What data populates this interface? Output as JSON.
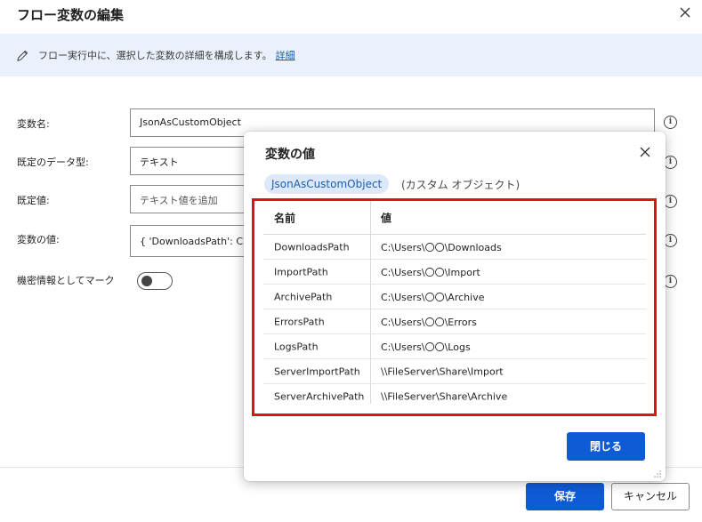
{
  "window": {
    "title": "フロー変数の編集"
  },
  "banner": {
    "text": "フロー実行中に、選択した変数の詳細を構成します。",
    "link": "詳細"
  },
  "form": {
    "name_label": "変数名:",
    "name_value": "JsonAsCustomObject",
    "type_label": "既定のデータ型:",
    "type_value": "テキスト",
    "default_label": "既定値:",
    "default_placeholder": "テキスト値を追加",
    "value_label": "変数の値:",
    "value_value": "{ 'DownloadsPath': C:\\Us",
    "sensitive_label": "機密情報としてマーク",
    "sensitive_on": false
  },
  "footer": {
    "save": "保存",
    "cancel": "キャンセル"
  },
  "dialog": {
    "title": "変数の値",
    "chip": "JsonAsCustomObject",
    "type_text": "(カスタム オブジェクト)",
    "columns": [
      "名前",
      "値"
    ],
    "rows": [
      [
        "DownloadsPath",
        "C:\\Users\\〇〇\\Downloads"
      ],
      [
        "ImportPath",
        "C:\\Users\\〇〇\\Import"
      ],
      [
        "ArchivePath",
        "C:\\Users\\〇〇\\Archive"
      ],
      [
        "ErrorsPath",
        "C:\\Users\\〇〇\\Errors"
      ],
      [
        "LogsPath",
        "C:\\Users\\〇〇\\Logs"
      ],
      [
        "ServerImportPath",
        "\\\\FileServer\\Share\\Import"
      ],
      [
        "ServerArchivePath",
        "\\\\FileServer\\Share\\Archive"
      ]
    ],
    "close_button": "閉じる"
  },
  "colors": {
    "accent": "#0f5bd6",
    "banner_bg": "#eaf1fc",
    "highlight": "#e31212",
    "chip_bg": "#dde8f8"
  }
}
